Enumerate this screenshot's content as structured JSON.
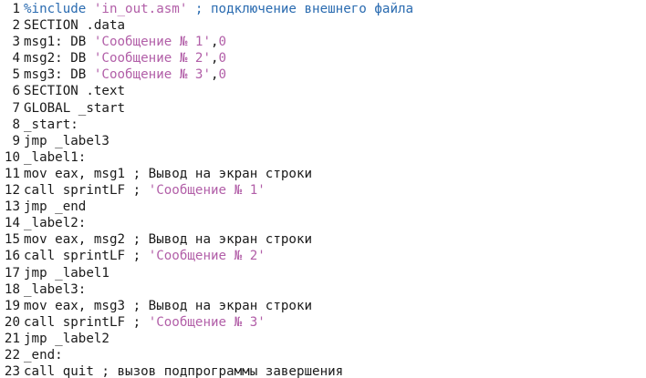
{
  "colors": {
    "string": "#b25fa8",
    "preprocessor": "#2a6bb0",
    "text": "#1a1a1a",
    "background": "#ffffff"
  },
  "editor": {
    "lines": [
      {
        "num": "1",
        "tokens": [
          {
            "t": "%include ",
            "k": "preproc"
          },
          {
            "t": "'in_out.asm'",
            "k": "str"
          },
          {
            "t": " ; подключение внешнего файла",
            "k": "preproc"
          }
        ]
      },
      {
        "num": "2",
        "tokens": [
          {
            "t": "SECTION .data",
            "k": "plain"
          }
        ]
      },
      {
        "num": "3",
        "tokens": [
          {
            "t": "msg1: DB ",
            "k": "plain"
          },
          {
            "t": "'Сообщение № 1'",
            "k": "str"
          },
          {
            "t": ",",
            "k": "plain"
          },
          {
            "t": "0",
            "k": "str"
          }
        ]
      },
      {
        "num": "4",
        "tokens": [
          {
            "t": "msg2: DB ",
            "k": "plain"
          },
          {
            "t": "'Сообщение № 2'",
            "k": "str"
          },
          {
            "t": ",",
            "k": "plain"
          },
          {
            "t": "0",
            "k": "str"
          }
        ]
      },
      {
        "num": "5",
        "tokens": [
          {
            "t": "msg3: DB ",
            "k": "plain"
          },
          {
            "t": "'Сообщение № 3'",
            "k": "str"
          },
          {
            "t": ",",
            "k": "plain"
          },
          {
            "t": "0",
            "k": "str"
          }
        ]
      },
      {
        "num": "6",
        "tokens": [
          {
            "t": "SECTION .text",
            "k": "plain"
          }
        ]
      },
      {
        "num": "7",
        "tokens": [
          {
            "t": "GLOBAL _start",
            "k": "plain"
          }
        ]
      },
      {
        "num": "8",
        "tokens": [
          {
            "t": "_start:",
            "k": "label"
          }
        ]
      },
      {
        "num": "9",
        "tokens": [
          {
            "t": "jmp _label3",
            "k": "plain"
          }
        ]
      },
      {
        "num": "10",
        "tokens": [
          {
            "t": "_label1:",
            "k": "label"
          }
        ]
      },
      {
        "num": "11",
        "tokens": [
          {
            "t": "mov eax, msg1 ",
            "k": "plain"
          },
          {
            "t": "; Вывод на экран строки",
            "k": "cmt"
          }
        ]
      },
      {
        "num": "12",
        "tokens": [
          {
            "t": "call sprintLF ",
            "k": "plain"
          },
          {
            "t": "; ",
            "k": "cmt"
          },
          {
            "t": "'Сообщение № 1'",
            "k": "str"
          }
        ]
      },
      {
        "num": "13",
        "tokens": [
          {
            "t": "jmp _end",
            "k": "plain"
          }
        ]
      },
      {
        "num": "14",
        "tokens": [
          {
            "t": "_label2:",
            "k": "label"
          }
        ]
      },
      {
        "num": "15",
        "tokens": [
          {
            "t": "mov eax, msg2 ",
            "k": "plain"
          },
          {
            "t": "; Вывод на экран строки",
            "k": "cmt"
          }
        ]
      },
      {
        "num": "16",
        "tokens": [
          {
            "t": "call sprintLF ",
            "k": "plain"
          },
          {
            "t": "; ",
            "k": "cmt"
          },
          {
            "t": "'Сообщение № 2'",
            "k": "str"
          }
        ]
      },
      {
        "num": "17",
        "tokens": [
          {
            "t": "jmp _label1",
            "k": "plain"
          }
        ]
      },
      {
        "num": "18",
        "tokens": [
          {
            "t": "_label3:",
            "k": "label"
          }
        ]
      },
      {
        "num": "19",
        "tokens": [
          {
            "t": "mov eax, msg3 ",
            "k": "plain"
          },
          {
            "t": "; Вывод на экран строки",
            "k": "cmt"
          }
        ]
      },
      {
        "num": "20",
        "tokens": [
          {
            "t": "call sprintLF ",
            "k": "plain"
          },
          {
            "t": "; ",
            "k": "cmt"
          },
          {
            "t": "'Сообщение № 3'",
            "k": "str"
          }
        ]
      },
      {
        "num": "21",
        "tokens": [
          {
            "t": "jmp _label2",
            "k": "plain"
          }
        ]
      },
      {
        "num": "22",
        "tokens": [
          {
            "t": "_end:",
            "k": "label"
          }
        ]
      },
      {
        "num": "23",
        "tokens": [
          {
            "t": "call quit ",
            "k": "plain"
          },
          {
            "t": "; вызов подпрограммы завершения",
            "k": "cmt"
          }
        ]
      }
    ]
  }
}
